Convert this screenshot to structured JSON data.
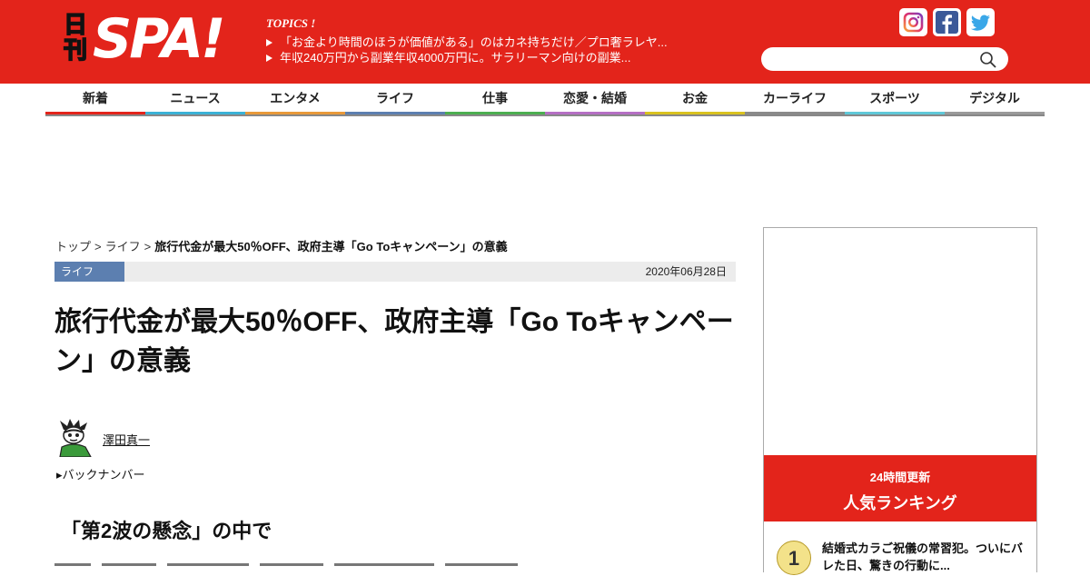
{
  "header": {
    "logo_small": "日刊",
    "logo_main": "SPA!",
    "topics_label": "TOPICS !",
    "topics": [
      "「お金より時間のほうが価値がある」のはカネ持ちだけ／プロ奢ラレヤ...",
      "年収240万円から副業年収4000万円に。サラリーマン向けの副業..."
    ],
    "social": [
      "instagram-icon",
      "facebook-icon",
      "twitter-icon"
    ],
    "search": {
      "value": "",
      "placeholder": ""
    }
  },
  "nav": {
    "items": [
      {
        "label": "新着",
        "color": "#e3241b"
      },
      {
        "label": "ニュース",
        "color": "#3bb2d6"
      },
      {
        "label": "エンタメ",
        "color": "#e8993a"
      },
      {
        "label": "ライフ",
        "color": "#5c7fb0"
      },
      {
        "label": "仕事",
        "color": "#4caf50"
      },
      {
        "label": "恋愛・結婚",
        "color": "#b56fc4"
      },
      {
        "label": "お金",
        "color": "#d9c21f"
      },
      {
        "label": "カーライフ",
        "color": "#8a8a8a"
      },
      {
        "label": "スポーツ",
        "color": "#5fc8d8"
      },
      {
        "label": "デジタル",
        "color": "#9a9a9a"
      }
    ]
  },
  "breadcrumb": {
    "home": "トップ",
    "category": "ライフ",
    "current": "旅行代金が最大50％OFF、政府主導「Go Toキャンペーン」の意義",
    "separator": ">"
  },
  "article": {
    "category": "ライフ",
    "date": "2020年06月28日",
    "title": "旅行代金が最大50％OFF、政府主導「Go Toキャンペーン」の意義",
    "author": "澤田真一",
    "backnumber": "▸バックナンバー",
    "section_heading": "「第2波の懸念」の中で"
  },
  "sidebar": {
    "ranking_sub": "24時間更新",
    "ranking_title": "人気ランキング",
    "ranking": [
      {
        "rank": "1",
        "title": "結婚式カラご祝儀の常習犯。ついにバレた日、驚きの行動に..."
      }
    ]
  },
  "colors": {
    "brand_red": "#e3241b",
    "life_blue": "#5c7fb0"
  }
}
